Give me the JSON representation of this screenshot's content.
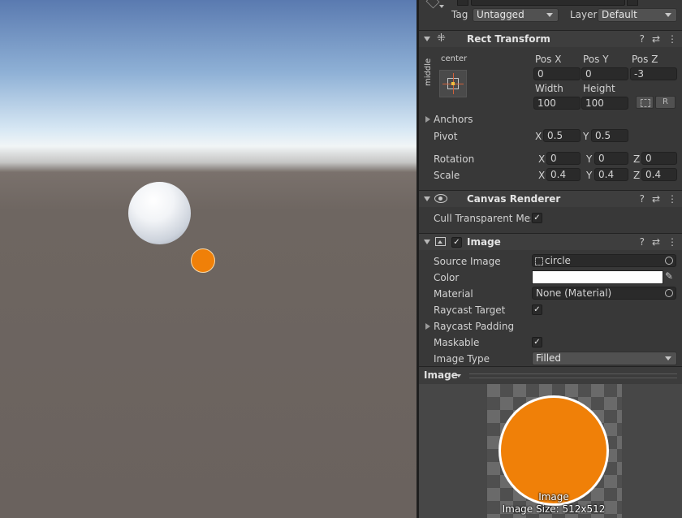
{
  "header": {
    "tag_label": "Tag",
    "tag_value": "Untagged",
    "layer_label": "Layer",
    "layer_value": "Default"
  },
  "rect_transform": {
    "title": "Rect Transform",
    "anchor_h": "center",
    "anchor_v": "middle",
    "pos_x_label": "Pos X",
    "pos_y_label": "Pos Y",
    "pos_z_label": "Pos Z",
    "pos_x": "0",
    "pos_y": "0",
    "pos_z": "-3",
    "width_label": "Width",
    "height_label": "Height",
    "width": "100",
    "height": "100",
    "r_button": "R",
    "anchors_label": "Anchors",
    "pivot_label": "Pivot",
    "pivot_x": "0.5",
    "pivot_y": "0.5",
    "rotation_label": "Rotation",
    "rot_x": "0",
    "rot_y": "0",
    "rot_z": "0",
    "scale_label": "Scale",
    "scale_x": "0.4",
    "scale_y": "0.4",
    "scale_z": "0.4",
    "x": "X",
    "y": "Y",
    "z": "Z"
  },
  "canvas_renderer": {
    "title": "Canvas Renderer",
    "cull_label": "Cull Transparent Mes"
  },
  "image": {
    "title": "Image",
    "source_label": "Source Image",
    "source_value": "circle",
    "color_label": "Color",
    "color_value": "#ffffff",
    "material_label": "Material",
    "material_value": "None (Material)",
    "raycast_target_label": "Raycast Target",
    "raycast_padding_label": "Raycast Padding",
    "maskable_label": "Maskable",
    "image_type_label": "Image Type",
    "image_type_value": "Filled"
  },
  "preview": {
    "dropdown": "Image",
    "name": "Image",
    "size": "Image Size: 512x512",
    "circle_color": "#f08008"
  },
  "scene": {
    "sphere_color": "#f2f4f7",
    "dot_color": "#f08008"
  }
}
